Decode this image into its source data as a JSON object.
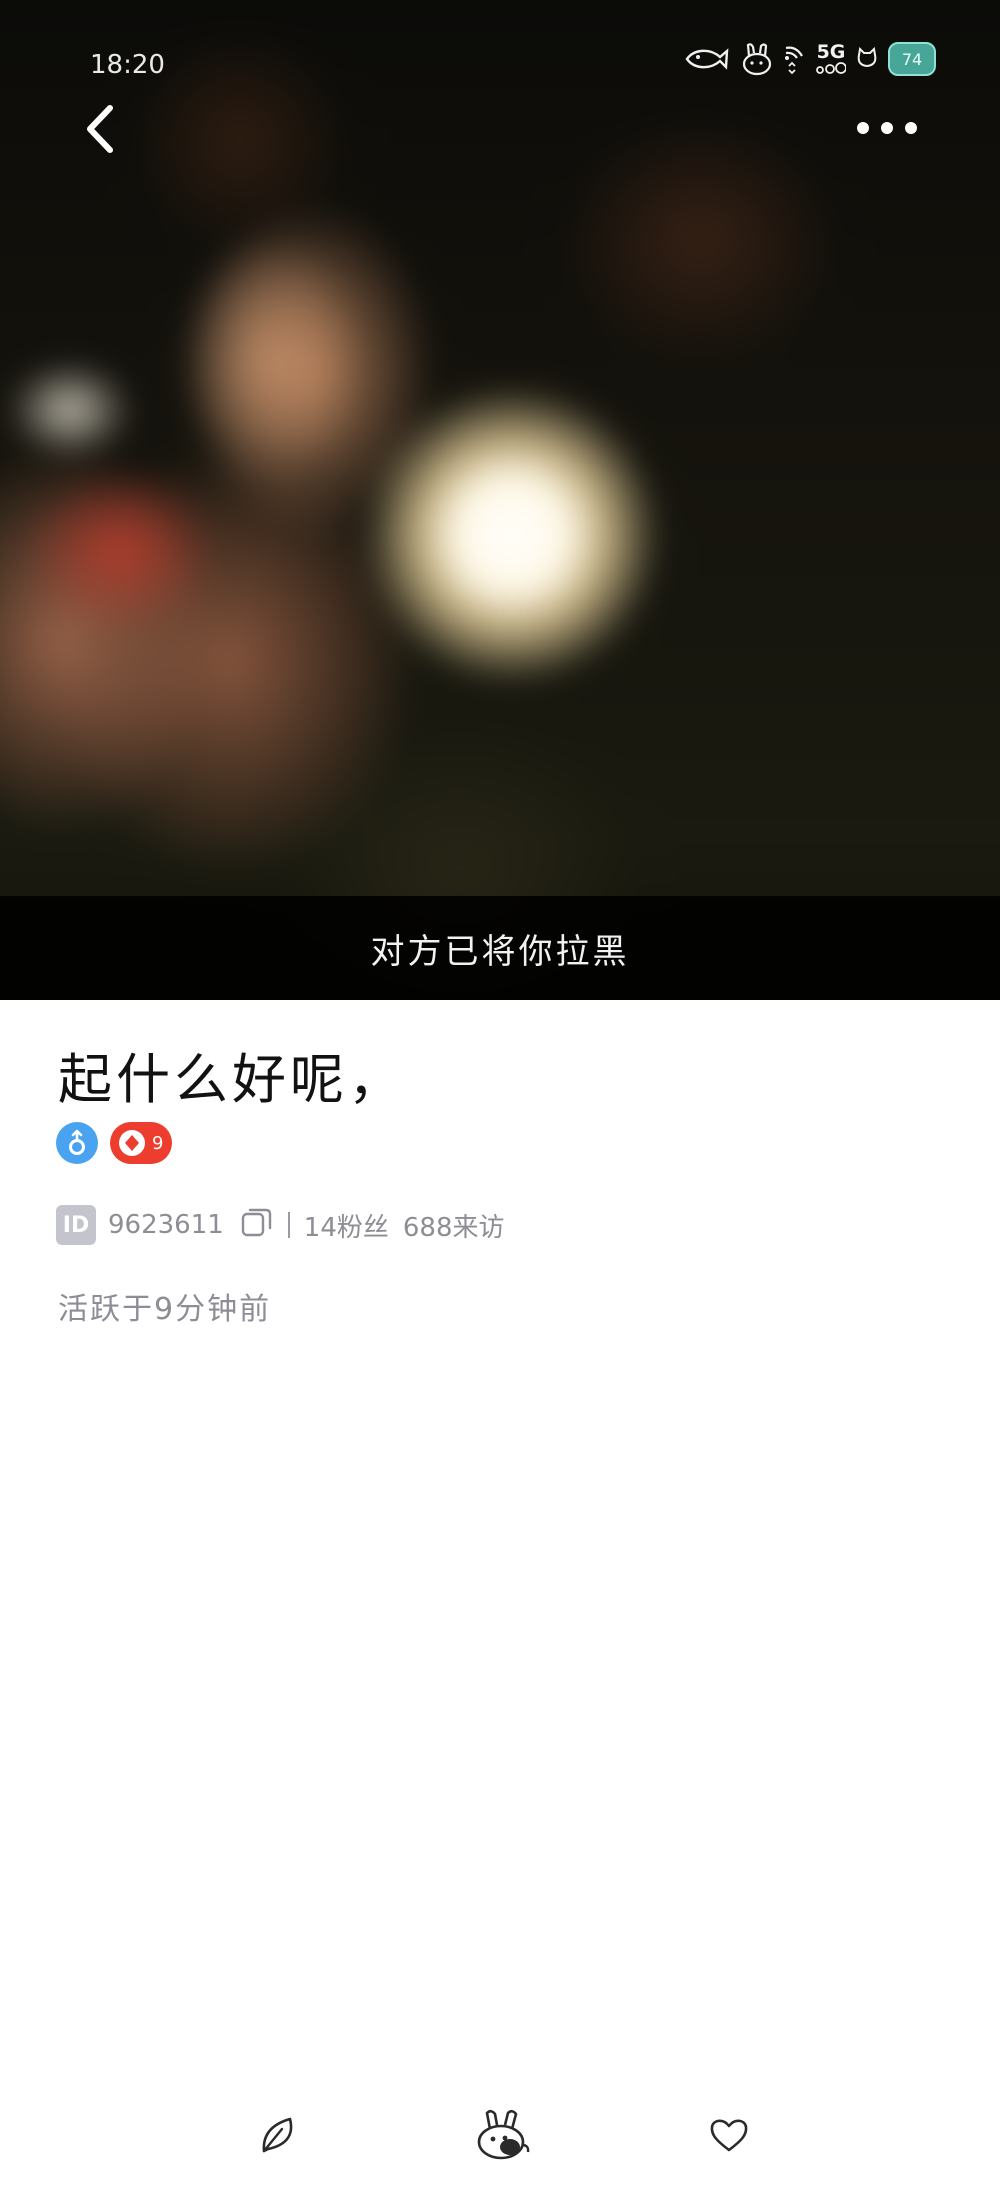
{
  "status_bar": {
    "time": "18:20",
    "network": "5G",
    "battery": "74"
  },
  "header": {
    "blocked_notice": "对方已将你拉黑"
  },
  "profile": {
    "name": "起什么好呢，",
    "gender": "male",
    "level": "9",
    "id_tag": "ID",
    "id_number": "9623611",
    "fans": "14粉丝",
    "visitors": "688来访",
    "active": "活跃于9分钟前"
  },
  "colors": {
    "gender_badge": "#4aa3f0",
    "level_badge": "#ec3d2f",
    "battery": "#48a699",
    "blocked_bar": "#000000"
  },
  "icons": {
    "back": "chevron-left-icon",
    "more": "more-dots-icon",
    "copy": "copy-icon",
    "bottom_left": "leaf-icon",
    "bottom_center": "bunny-mascot-icon",
    "bottom_right": "heart-icon"
  }
}
